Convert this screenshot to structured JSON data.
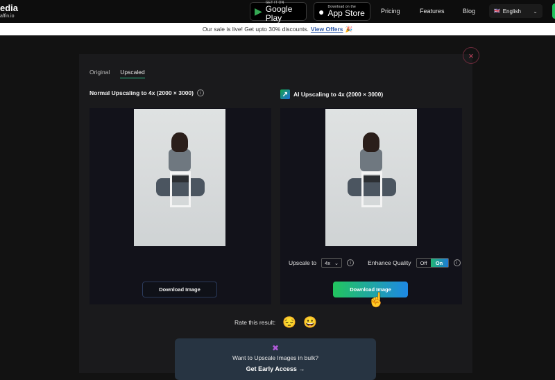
{
  "header": {
    "logo_line1": "edia",
    "logo_line2": "affin.io",
    "google_play": {
      "small": "GET IT ON",
      "big": "Google Play"
    },
    "app_store": {
      "small": "Download on the",
      "big": "App Store"
    },
    "nav": [
      "Pricing",
      "Features",
      "Blog"
    ],
    "language": {
      "flag": "🇬🇧",
      "label": "English"
    }
  },
  "banner": {
    "text": "Our sale is live! Get upto 30% discounts.",
    "link": "View Offers",
    "emoji": "🎉"
  },
  "modal": {
    "close_glyph": "×",
    "tabs": [
      {
        "label": "Original"
      },
      {
        "label": "Upscaled",
        "active": true
      }
    ],
    "normal": {
      "title": "Normal Upscaling to 4x (2000 × 3000)",
      "download": "Download Image"
    },
    "ai": {
      "title": "AI Upscaling to 4x (2000 × 3000)",
      "upscale_label": "Upscale to",
      "upscale_value": "4x",
      "enhance_label": "Enhance Quality",
      "toggle_off": "Off",
      "toggle_on": "On",
      "enhance_state": "On",
      "download": "Download Image"
    },
    "rate": {
      "label": "Rate this result:",
      "sad": "😔",
      "happy": "😀"
    },
    "bulk": {
      "text": "Want to Upscale Images in bulk?",
      "cta": "Get Early Access →"
    }
  },
  "colors": {
    "accent_green": "#22c55e",
    "accent_blue": "#1e88e5",
    "close_red": "#c0405a",
    "link_blue": "#2f5aa8"
  }
}
